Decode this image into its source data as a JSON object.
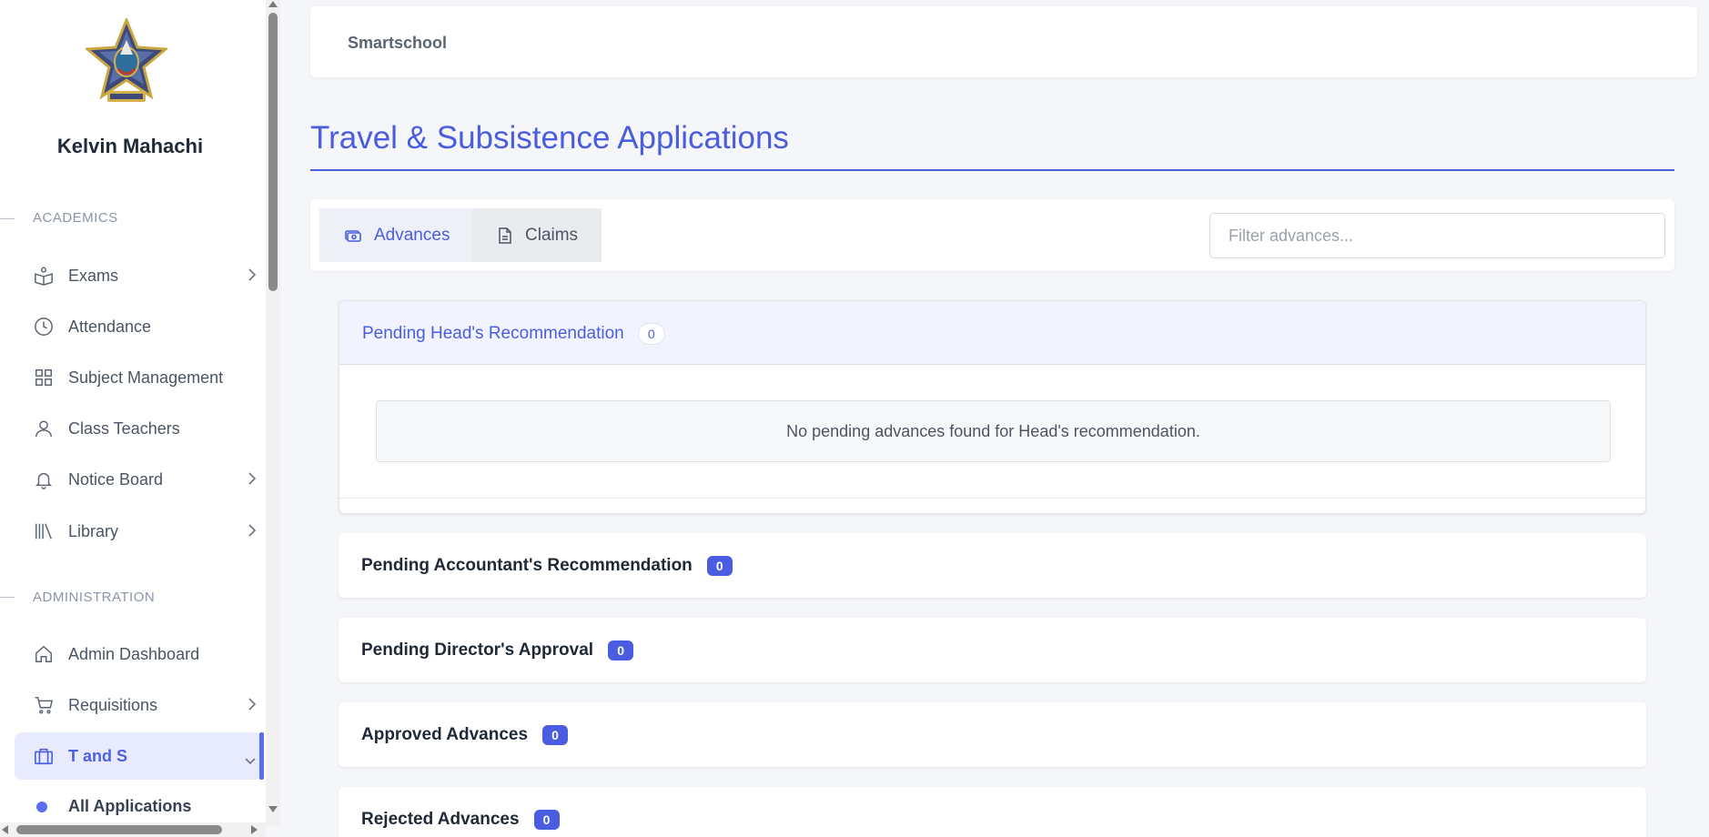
{
  "app": {
    "name": "Smartschool"
  },
  "user": {
    "name": "Kelvin Mahachi"
  },
  "sidebar": {
    "sections": [
      {
        "label": "ACADEMICS"
      },
      {
        "label": "ADMINISTRATION"
      }
    ],
    "items": [
      {
        "label": "Exams",
        "icon": "book-reader-icon",
        "has_submenu": true
      },
      {
        "label": "Attendance",
        "icon": "clock-icon",
        "has_submenu": false
      },
      {
        "label": "Subject Management",
        "icon": "grid-icon",
        "has_submenu": false
      },
      {
        "label": "Class Teachers",
        "icon": "user-icon",
        "has_submenu": false
      },
      {
        "label": "Notice Board",
        "icon": "bell-icon",
        "has_submenu": true
      },
      {
        "label": "Library",
        "icon": "library-icon",
        "has_submenu": true
      },
      {
        "label": "Admin Dashboard",
        "icon": "home-icon",
        "has_submenu": false
      },
      {
        "label": "Requisitions",
        "icon": "cart-icon",
        "has_submenu": true
      },
      {
        "label": "T and S",
        "icon": "briefcase-icon",
        "has_submenu": true,
        "active": true
      }
    ],
    "subitems": [
      {
        "label": "All Applications"
      }
    ]
  },
  "page": {
    "title": "Travel & Subsistence Applications"
  },
  "tabs": [
    {
      "label": "Advances",
      "icon": "money-icon",
      "active": true
    },
    {
      "label": "Claims",
      "icon": "document-icon",
      "active": false
    }
  ],
  "filter": {
    "placeholder": "Filter advances...",
    "value": ""
  },
  "groups": [
    {
      "title": "Pending Head's Recommendation",
      "count": "0",
      "expanded": true,
      "empty_message": "No pending advances found for Head's recommendation."
    },
    {
      "title": "Pending Accountant's Recommendation",
      "count": "0",
      "expanded": false
    },
    {
      "title": "Pending Director's Approval",
      "count": "0",
      "expanded": false
    },
    {
      "title": "Approved Advances",
      "count": "0",
      "expanded": false
    },
    {
      "title": "Rejected Advances",
      "count": "0",
      "expanded": false
    }
  ],
  "colors": {
    "accent": "#4a5ce0",
    "active_bg": "#e8ebfd",
    "page_bg": "#f5f6fa"
  }
}
